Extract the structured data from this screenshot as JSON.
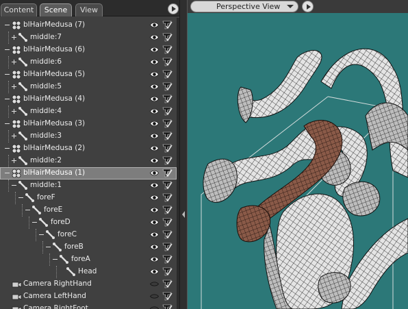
{
  "tabs": [
    {
      "label": "Content",
      "active": false
    },
    {
      "label": "Scene",
      "active": true
    },
    {
      "label": "View",
      "active": false
    }
  ],
  "scene_tree": [
    {
      "label": "blHairMedusa (7)",
      "type": "figure",
      "depth": 0,
      "expander": "minus",
      "selected": false,
      "visible": true
    },
    {
      "label": "middle:7",
      "type": "bone",
      "depth": 1,
      "expander": "plus",
      "selected": false,
      "visible": true
    },
    {
      "label": "blHairMedusa (6)",
      "type": "figure",
      "depth": 0,
      "expander": "minus",
      "selected": false,
      "visible": true
    },
    {
      "label": "middle:6",
      "type": "bone",
      "depth": 1,
      "expander": "plus",
      "selected": false,
      "visible": true
    },
    {
      "label": "blHairMedusa (5)",
      "type": "figure",
      "depth": 0,
      "expander": "minus",
      "selected": false,
      "visible": true
    },
    {
      "label": "middle:5",
      "type": "bone",
      "depth": 1,
      "expander": "plus",
      "selected": false,
      "visible": true
    },
    {
      "label": "blHairMedusa (4)",
      "type": "figure",
      "depth": 0,
      "expander": "minus",
      "selected": false,
      "visible": true
    },
    {
      "label": "middle:4",
      "type": "bone",
      "depth": 1,
      "expander": "plus",
      "selected": false,
      "visible": true
    },
    {
      "label": "blHairMedusa (3)",
      "type": "figure",
      "depth": 0,
      "expander": "minus",
      "selected": false,
      "visible": true
    },
    {
      "label": "middle:3",
      "type": "bone",
      "depth": 1,
      "expander": "plus",
      "selected": false,
      "visible": true
    },
    {
      "label": "blHairMedusa (2)",
      "type": "figure",
      "depth": 0,
      "expander": "minus",
      "selected": false,
      "visible": true
    },
    {
      "label": "middle:2",
      "type": "bone",
      "depth": 1,
      "expander": "plus",
      "selected": false,
      "visible": true
    },
    {
      "label": "blHairMedusa (1)",
      "type": "figure",
      "depth": 0,
      "expander": "minus",
      "selected": true,
      "visible": true
    },
    {
      "label": "middle:1",
      "type": "bone",
      "depth": 1,
      "expander": "minus",
      "selected": false,
      "visible": true
    },
    {
      "label": "foreF",
      "type": "bone",
      "depth": 2,
      "expander": "minus",
      "selected": false,
      "visible": true
    },
    {
      "label": "foreE",
      "type": "bone",
      "depth": 3,
      "expander": "minus",
      "selected": false,
      "visible": true
    },
    {
      "label": "foreD",
      "type": "bone",
      "depth": 4,
      "expander": "minus",
      "selected": false,
      "visible": true
    },
    {
      "label": "foreC",
      "type": "bone",
      "depth": 5,
      "expander": "minus",
      "selected": false,
      "visible": true
    },
    {
      "label": "foreB",
      "type": "bone",
      "depth": 6,
      "expander": "minus",
      "selected": false,
      "visible": true
    },
    {
      "label": "foreA",
      "type": "bone",
      "depth": 7,
      "expander": "minus",
      "selected": false,
      "visible": true
    },
    {
      "label": "Head",
      "type": "bone",
      "depth": 8,
      "expander": "none",
      "selected": false,
      "visible": true
    },
    {
      "label": "Camera RightHand",
      "type": "camera",
      "depth": 0,
      "expander": "none",
      "selected": false,
      "visible": false
    },
    {
      "label": "Camera LeftHand",
      "type": "camera",
      "depth": 0,
      "expander": "none",
      "selected": false,
      "visible": false
    },
    {
      "label": "Camera RightFoot",
      "type": "camera",
      "depth": 0,
      "expander": "none",
      "selected": false,
      "visible": false
    }
  ],
  "viewport": {
    "camera": "Perspective View",
    "background_color": "#2c7878",
    "wire_color": "#101010",
    "skin_light": "#e6e6e6",
    "skin_selected": "#8a5a48"
  },
  "icons": {
    "visible": "eye-icon",
    "hidden": "eye-closed-icon",
    "render": "checkmark-hand-icon",
    "figure": "figure-icon",
    "bone": "bone-icon",
    "camera": "camera-icon"
  }
}
